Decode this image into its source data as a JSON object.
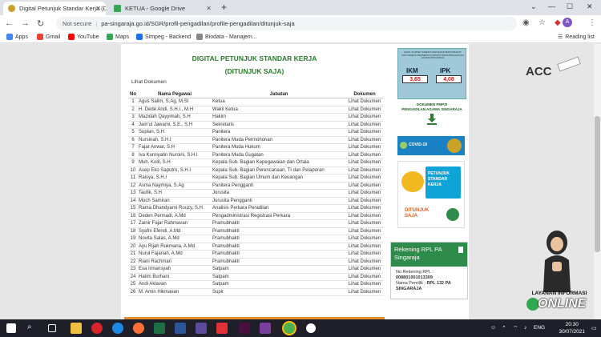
{
  "browser": {
    "tabs": [
      {
        "title": "Digital Petunjuk Standar Kerja (D",
        "active": true,
        "favicon_color": "#c8a02a"
      },
      {
        "title": "KETUA - Google Drive",
        "active": false,
        "favicon_color": "#34a853"
      }
    ],
    "new_tab_label": "+",
    "security_label": "Not secure",
    "url": "pa-singaraja.go.id/SGR/profil-pengadilan/profile-pengadilan/ditunjuk-saja",
    "bookmarks": [
      {
        "label": "Apps",
        "color": "#4285f4"
      },
      {
        "label": "Gmail",
        "color": "#ea4335"
      },
      {
        "label": "YouTube",
        "color": "#ff0000"
      },
      {
        "label": "Maps",
        "color": "#34a853"
      },
      {
        "label": "Simpeg - Backend",
        "color": "#1a73e8"
      },
      {
        "label": "Biodata - Manajem...",
        "color": "#888888"
      }
    ],
    "reading_list": "Reading list",
    "profile_initial": "A"
  },
  "page": {
    "title1": "DIGITAL PETUNJUK STANDAR KERJA",
    "title2": "(DITUNJUK SAJA)",
    "lihat_label": "Lihat Dokumen",
    "table": {
      "headers": [
        "No",
        "Nama Pegawai",
        "Jabatan",
        "Dokumen"
      ],
      "rows": [
        [
          "1",
          "Agus Salim, S.Ag, M.SI",
          "Ketua",
          "Lihat Dokumen"
        ],
        [
          "2",
          "H. Dede Andi, S.H.I., M.H",
          "Wakil Ketua",
          "Lihat Dokumen"
        ],
        [
          "3",
          "Mazidah Qayyimah, S.H",
          "Hakim",
          "Lihat Dokumen"
        ],
        [
          "4",
          "Jam'ul Jawami, S.E., S.H",
          "Sekretaris",
          "Lihat Dokumen"
        ],
        [
          "5",
          "Suplan, S.H",
          "Panitera",
          "Lihat Dokumen"
        ],
        [
          "6",
          "Nursinah, S.H.I",
          "Panitera Muda Permohonan",
          "Lihat Dokumen"
        ],
        [
          "7",
          "Fajar Anwar, S.H",
          "Panitera Muda Hukum",
          "Lihat Dokumen"
        ],
        [
          "8",
          "Iva Kurniyatin Nuroini, S.H.I",
          "Panitera Muda Gugatan",
          "Lihat Dokumen"
        ],
        [
          "9",
          "Muh. Kolil, S.H",
          "Kepala Sub. Bagian Kepegawaian dan Ortala",
          "Lihat Dokumen"
        ],
        [
          "10",
          "Asep Eko Saputro, S.H.I",
          "Kepala Sub. Bagian Perencanaan, TI dan Pelaporan",
          "Lihat Dokumen"
        ],
        [
          "11",
          "Raisya, S.H.I",
          "Kepala Sub. Bagian Umum dan Keuangan",
          "Lihat Dokumen"
        ],
        [
          "12",
          "Asma Naymiya, S.Ag",
          "Panitera Pengganti",
          "Lihat Dokumen"
        ],
        [
          "13",
          "Taufik, S.H",
          "Jurusita",
          "Lihat Dokumen"
        ],
        [
          "14",
          "Moch Samiran",
          "Jurusita Pengganti",
          "Lihat Dokumen"
        ],
        [
          "15",
          "Rama Dhandyarni Rouzy, S.H",
          "Analisis Perkara Peradilan",
          "Lihat Dokumen"
        ],
        [
          "16",
          "Deden Permadi, A.Md",
          "Pengadministrasi Registrasi Perkara",
          "Lihat Dokumen"
        ],
        [
          "17",
          "Zainir Fajar Rahmavan",
          "Pramubhakti",
          "Lihat Dokumen"
        ],
        [
          "18",
          "Syafni Efendi, A.Md",
          "Pramubhakti",
          "Lihat Dokumen"
        ],
        [
          "19",
          "Novita Salas, A.Md",
          "Pramubhakti",
          "Lihat Dokumen"
        ],
        [
          "20",
          "Ayu Rijah Rukmana, A.Md",
          "Pramubhakti",
          "Lihat Dokumen"
        ],
        [
          "21",
          "Nurul Fajariah, A.Md",
          "Pramubhakti",
          "Lihat Dokumen"
        ],
        [
          "22",
          "Riani Rachman",
          "Pramubhakti",
          "Lihat Dokumen"
        ],
        [
          "23",
          "Esa Irmansyah",
          "Satpam",
          "Lihat Dokumen"
        ],
        [
          "24",
          "Hatim Burhani",
          "Satpam",
          "Lihat Dokumen"
        ],
        [
          "25",
          "Andi Aklavan",
          "Satpam",
          "Lihat Dokumen"
        ],
        [
          "26",
          "M. Amin Hikmavan",
          "Supir",
          "Lihat Dokumen"
        ]
      ]
    }
  },
  "sidebar": {
    "ikm": {
      "header": "HASIL SURVEY INDEKS KEPUASAN MASYARAKAT DAN INDEKS PERSEPSI KORUPSI PADA PENGADILAN AGAMA SINGARAJA",
      "ikm_label": "IKM",
      "ikm_value": "3,65",
      "ipk_label": "IPK",
      "ipk_value": "4,08"
    },
    "pmpzi": {
      "line1": "DOKUMEN PMPZI",
      "line2": "PENGADILAN AGAMA SINGARAJA"
    },
    "covid": {
      "text": "COVID-19"
    },
    "petunjuk": {
      "line1": "PETUNJUK",
      "line2": "STANDAR",
      "line3": "KERJA",
      "line4": "DITUNJUK",
      "line5": "SAJA"
    },
    "rekening": {
      "title": "Rekening RPL PA Singaraja",
      "no_label": "No Rekening RPL :",
      "no_value": "008801001013309",
      "owner_label": "Nama Pemilik :",
      "owner_value": "RPL 132 PA SINGARAJA"
    }
  },
  "rightpanel": {
    "acc_label": "ACC",
    "layanan_line1": "LAYANAN INFORMASI",
    "layanan_line2": "ONLINE"
  },
  "taskbar": {
    "lang": "ENG",
    "time": "20:30",
    "date": "30/07/2021"
  },
  "colors": {
    "green": "#2a7a2a",
    "rek_green": "#2e8b4a",
    "accent_orange": "#e0902a"
  }
}
